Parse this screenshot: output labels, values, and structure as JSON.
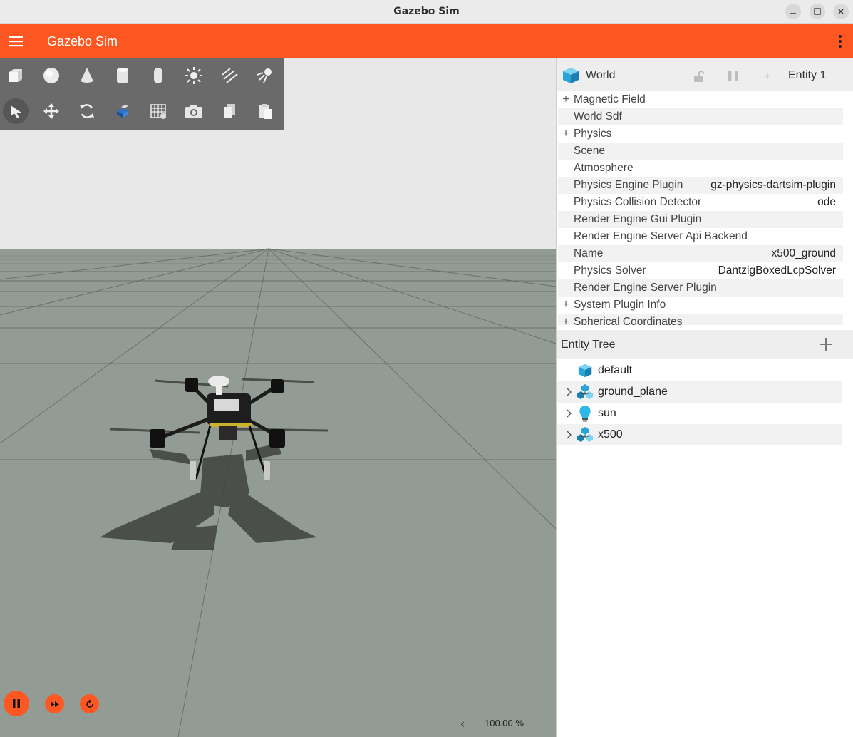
{
  "window": {
    "title": "Gazebo Sim"
  },
  "header": {
    "title": "Gazebo Sim"
  },
  "colors": {
    "accent": "#fe5722",
    "toolbar": "#6a6a6a",
    "ground": "#929c94",
    "sky": "#e8e8e8",
    "entity_icon": "#29a4d9"
  },
  "toolbar": {
    "row1": [
      "box-icon",
      "sphere-icon",
      "cone-icon",
      "cylinder-icon",
      "capsule-icon",
      "point-light-icon",
      "directional-light-icon",
      "spot-light-icon"
    ],
    "row2": [
      "select-icon",
      "translate-icon",
      "rotate-icon",
      "transform-snap-icon",
      "grid-icon",
      "camera-icon",
      "copy-icon",
      "paste-icon"
    ]
  },
  "playback": {
    "pause_icon": "pause-icon",
    "step_icon": "fast-forward-icon",
    "reset_icon": "reset-icon"
  },
  "zoom": {
    "arrow": "‹",
    "level": "100.00 %"
  },
  "component_inspector": {
    "title": "World",
    "entity": "Entity 1",
    "rows": [
      {
        "key": "Magnetic Field",
        "value": "",
        "expandable": true
      },
      {
        "key": "World Sdf",
        "value": "",
        "expandable": false
      },
      {
        "key": "Physics",
        "value": "",
        "expandable": true
      },
      {
        "key": "Scene",
        "value": "",
        "expandable": false
      },
      {
        "key": "Atmosphere",
        "value": "",
        "expandable": false
      },
      {
        "key": "Physics Engine Plugin",
        "value": "gz-physics-dartsim-plugin",
        "expandable": false
      },
      {
        "key": "Physics Collision Detector",
        "value": "ode",
        "expandable": false
      },
      {
        "key": "Render Engine Gui Plugin",
        "value": "",
        "expandable": false
      },
      {
        "key": "Render Engine Server Api Backend",
        "value": "",
        "expandable": false
      },
      {
        "key": "Name",
        "value": "x500_ground",
        "expandable": false
      },
      {
        "key": "Physics Solver",
        "value": "DantzigBoxedLcpSolver",
        "expandable": false
      },
      {
        "key": "Render Engine Server Plugin",
        "value": "",
        "expandable": false
      },
      {
        "key": "System Plugin Info",
        "value": "",
        "expandable": true
      },
      {
        "key": "Spherical Coordinates",
        "value": "",
        "expandable": true
      }
    ]
  },
  "entity_tree": {
    "title": "Entity Tree",
    "items": [
      {
        "name": "default",
        "icon": "world-icon",
        "expandable": false
      },
      {
        "name": "ground_plane",
        "icon": "model-icon",
        "expandable": true
      },
      {
        "name": "sun",
        "icon": "light-bulb-icon",
        "expandable": true
      },
      {
        "name": "x500",
        "icon": "model-icon",
        "expandable": true
      }
    ]
  }
}
